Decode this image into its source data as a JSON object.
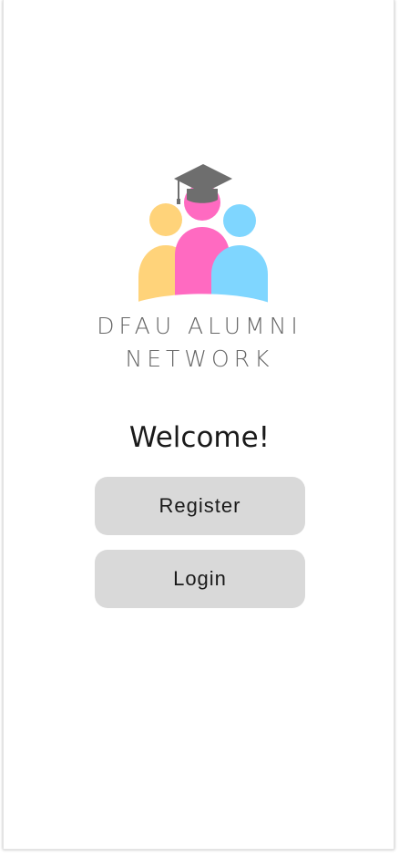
{
  "logo": {
    "line1": "DFAU ALUMNI",
    "line2": "NETWORK",
    "colors": {
      "left_person": "#FFD37A",
      "center_person": "#FF6AC1",
      "right_person": "#7FD6FF",
      "cap": "#6E6E6E"
    }
  },
  "welcome": {
    "title": "Welcome!"
  },
  "buttons": {
    "register_label": "Register",
    "login_label": "Login"
  }
}
